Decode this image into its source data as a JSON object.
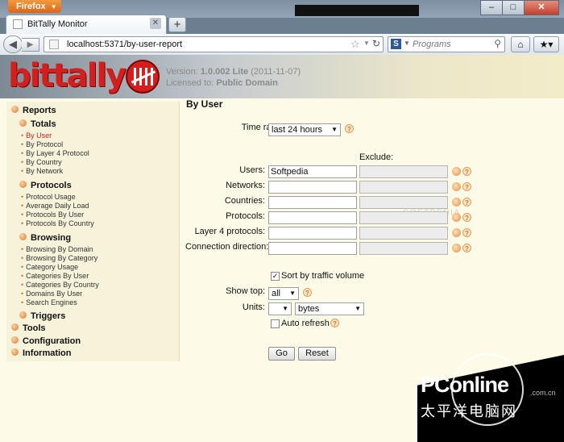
{
  "browser": {
    "app_button": "Firefox",
    "tab_title": "BitTally Monitor",
    "new_tab": "+",
    "url": "localhost:5371/by-user-report",
    "search_placeholder": "Programs",
    "search_engine_letter": "S",
    "window_buttons": [
      "–",
      "□",
      "✕"
    ]
  },
  "header": {
    "logo_text": "bittally",
    "version_label": "Version:",
    "version_value": "1.0.002 Lite",
    "version_date": "(2011-11-07)",
    "license_label": "Licensed to:",
    "license_value": "Public Domain"
  },
  "sidebar": {
    "reports": "Reports",
    "totals": "Totals",
    "totals_links": [
      "By User",
      "By Protocol",
      "By Layer 4 Protocol",
      "By Country",
      "By Network"
    ],
    "protocols": "Protocols",
    "protocols_links": [
      "Protocol Usage",
      "Average Daily Load",
      "Protocols By User",
      "Protocols By Country"
    ],
    "browsing": "Browsing",
    "browsing_links": [
      "Browsing By Domain",
      "Browsing By Category",
      "Category Usage",
      "Categories By User",
      "Categories By Country",
      "Domains By User",
      "Search Engines"
    ],
    "triggers": "Triggers",
    "tools": "Tools",
    "configuration": "Configuration",
    "information": "Information"
  },
  "form": {
    "title": "By User",
    "time_range_label": "Time range:",
    "time_range_value": "last 24 hours",
    "exclude_label": "Exclude:",
    "rows": [
      {
        "label": "Users:",
        "value": "Softpedia"
      },
      {
        "label": "Networks:",
        "value": ""
      },
      {
        "label": "Countries:",
        "value": ""
      },
      {
        "label": "Protocols:",
        "value": ""
      },
      {
        "label": "Layer 4 protocols:",
        "value": ""
      },
      {
        "label": "Connection direction:",
        "value": ""
      }
    ],
    "sort_label": "Sort by traffic volume",
    "sort_checked": true,
    "show_top_label": "Show top:",
    "show_top_value": "all",
    "units_label": "Units:",
    "units_prefix_value": "",
    "units_value": "bytes",
    "auto_refresh_label": "Auto refresh",
    "auto_refresh_checked": false,
    "go_button": "Go",
    "reset_button": "Reset"
  },
  "watermark": {
    "softpedia": "SOFTPEDIA",
    "brand": "PConline",
    "domain": ".com.cn",
    "chinese": "太平洋电脑网"
  }
}
